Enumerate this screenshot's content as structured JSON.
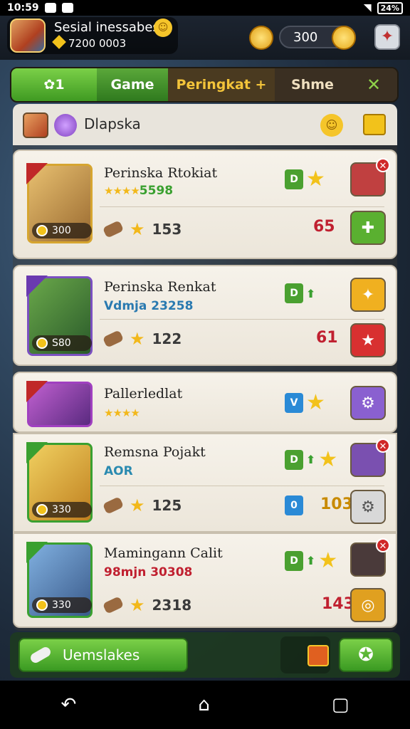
{
  "status_bar": {
    "time": "10:59",
    "battery": "24%"
  },
  "header": {
    "player_name": "Sesial inessabes",
    "coins": "7200 0003",
    "currency": "300"
  },
  "tabs": [
    {
      "label": "1"
    },
    {
      "label": "Game"
    },
    {
      "label": "Peringkat +"
    },
    {
      "label": "Shme"
    }
  ],
  "panel": {
    "title": "Dlapska"
  },
  "cards": [
    {
      "title": "Perinska Rtokiat",
      "sub": "5598",
      "count": "153",
      "ptag": "300",
      "right": "65"
    },
    {
      "title": "Perinska Renkat",
      "sub": "Vdmja 23258",
      "count": "122",
      "ptag": "S80",
      "right": "61"
    },
    {
      "title": "Pallerledlat",
      "sub": "",
      "count": "",
      "ptag": "",
      "right": ""
    },
    {
      "title": "Remsna Pojakt",
      "sub": "AOR",
      "count": "125",
      "ptag": "330",
      "right": "103",
      "blue": "0"
    },
    {
      "title": "Mamingann Calit",
      "sub": "98mjn 30308",
      "count": "2318",
      "ptag": "330",
      "right": "143"
    }
  ],
  "bottom": {
    "primary_label": "Uemslakes"
  },
  "colors": {
    "accent_green": "#4aa030",
    "gold": "#f2c21b",
    "alert_red": "#c02030"
  }
}
